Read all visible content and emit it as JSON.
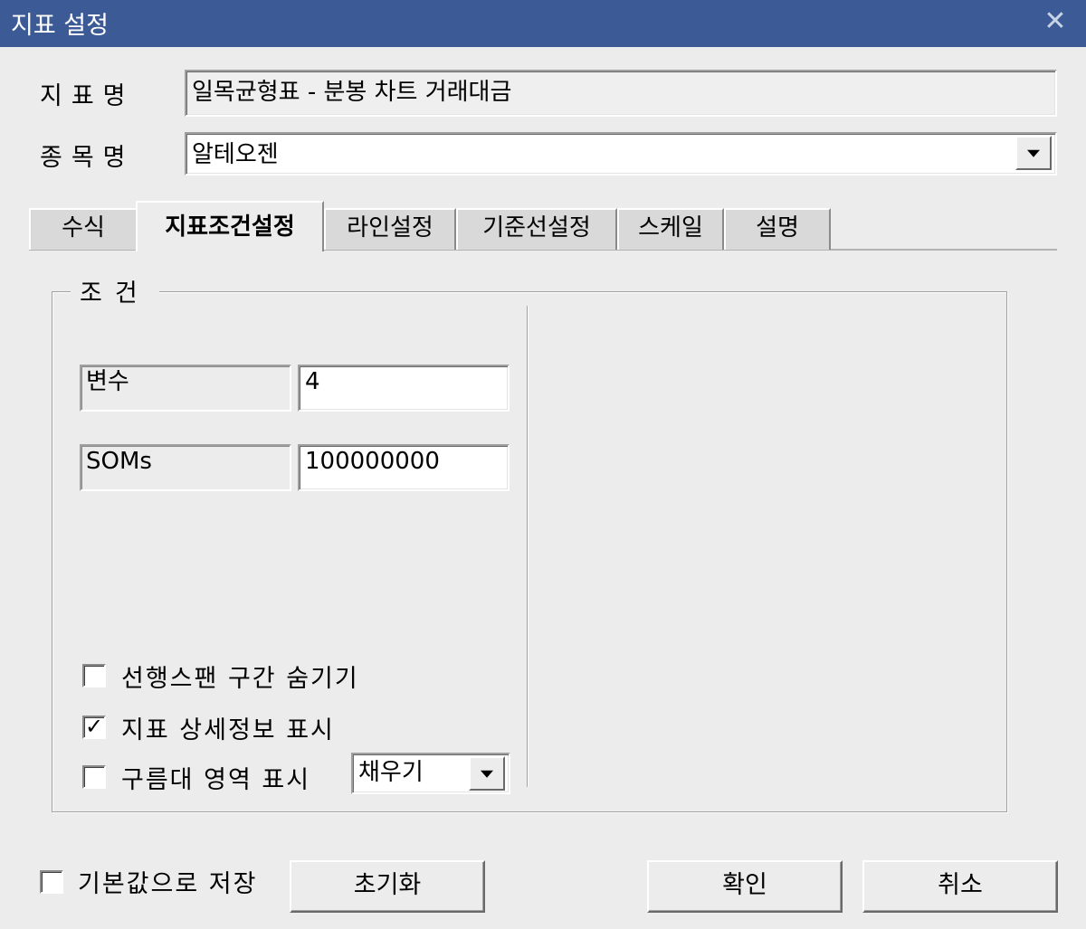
{
  "window": {
    "title": "지표 설정",
    "close_icon": "close-icon"
  },
  "fields": {
    "indicator_label": "지표명",
    "indicator_value": "일목균형표 - 분봉 차트 거래대금",
    "symbol_label": "종목명",
    "symbol_value": "알테오젠"
  },
  "tabs": [
    {
      "label": "수식",
      "active": false
    },
    {
      "label": "지표조건설정",
      "active": true
    },
    {
      "label": "라인설정",
      "active": false
    },
    {
      "label": "기준선설정",
      "active": false
    },
    {
      "label": "스케일",
      "active": false
    },
    {
      "label": "설명",
      "active": false
    }
  ],
  "conditions": {
    "group_label": "조건",
    "params": [
      {
        "label": "변수",
        "value": "4"
      },
      {
        "label": "SOMs",
        "value": "100000000"
      }
    ],
    "checkboxes": [
      {
        "label": "선행스팬 구간 숨기기",
        "checked": false
      },
      {
        "label": "지표 상세정보 표시",
        "checked": true
      },
      {
        "label": "구름대 영역 표시",
        "checked": false
      }
    ],
    "fill_select": {
      "selected": "채우기"
    }
  },
  "footer": {
    "save_default_label": "기본값으로 저장",
    "save_default_checked": false,
    "reset_label": "초기화",
    "ok_label": "확인",
    "cancel_label": "취소"
  }
}
